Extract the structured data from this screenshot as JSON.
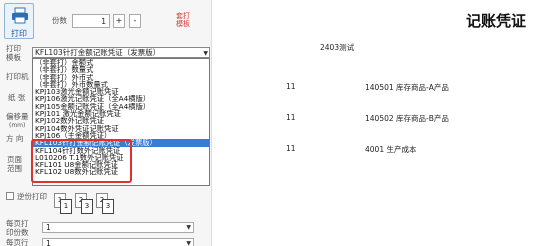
{
  "toolbar": {
    "print_label": "打印",
    "copies_label": "份数",
    "copies_value": "1",
    "plus_label": "+",
    "minus_label": "-",
    "note_line1": "套打",
    "note_line2": "模板"
  },
  "labels": {
    "print_template_line1": "打印",
    "print_template_line2": "模板",
    "printer": "打印机",
    "paper": "纸 张",
    "offset_line1": "偏移量",
    "offset_line2": "(mm)",
    "direction": "方 向",
    "page_range_line1": "页面",
    "page_range_line2": "范围",
    "reverse_print": "逆份打印",
    "per_page_copies_line1": "每页打",
    "per_page_copies_line2": "印份数",
    "per_page_copies_value": "1",
    "per_page_rows_line1": "每页行",
    "per_page_rows_value": "1"
  },
  "order_icons": [
    "1",
    "1",
    "2",
    "3",
    "2",
    "3"
  ],
  "template_select": {
    "selected": "KFL103针打金额记账凭证（发票版）",
    "options": [
      "（非套打）金额式",
      "（非套打）数量式",
      "（非套打）外币式",
      "（非套打）外币数量式",
      "KPJ103激光金额记账凭证",
      "KPJ106激光记账凭证（全A4横版）",
      "KPJ105金额记账凭证（全A4横版）",
      "KPJ101 激光金额记账凭证",
      "KPJ102数外记账凭证",
      "KPJ104数外凭证记账凭证",
      "KPJ106（主金额凭证）",
      "KFL103针打金额记账凭证（发票版）",
      "KFL104针打数外记账凭证",
      "L010206  T.1数外记账凭证",
      "KFL101 U8金额记账凭证",
      "KFL102 U8数外记账凭证"
    ],
    "selected_index": 11
  },
  "preview": {
    "title": "记账凭证",
    "description": "2403测试",
    "rows": [
      {
        "num": "11",
        "account": "140501 库存商品-A产品"
      },
      {
        "num": "11",
        "account": "140502 库存商品-B产品"
      },
      {
        "num": "11",
        "account": "4001 生产成本"
      }
    ]
  },
  "colors": {
    "highlight": "#3a7bd5",
    "annotation": "#e0312a"
  }
}
